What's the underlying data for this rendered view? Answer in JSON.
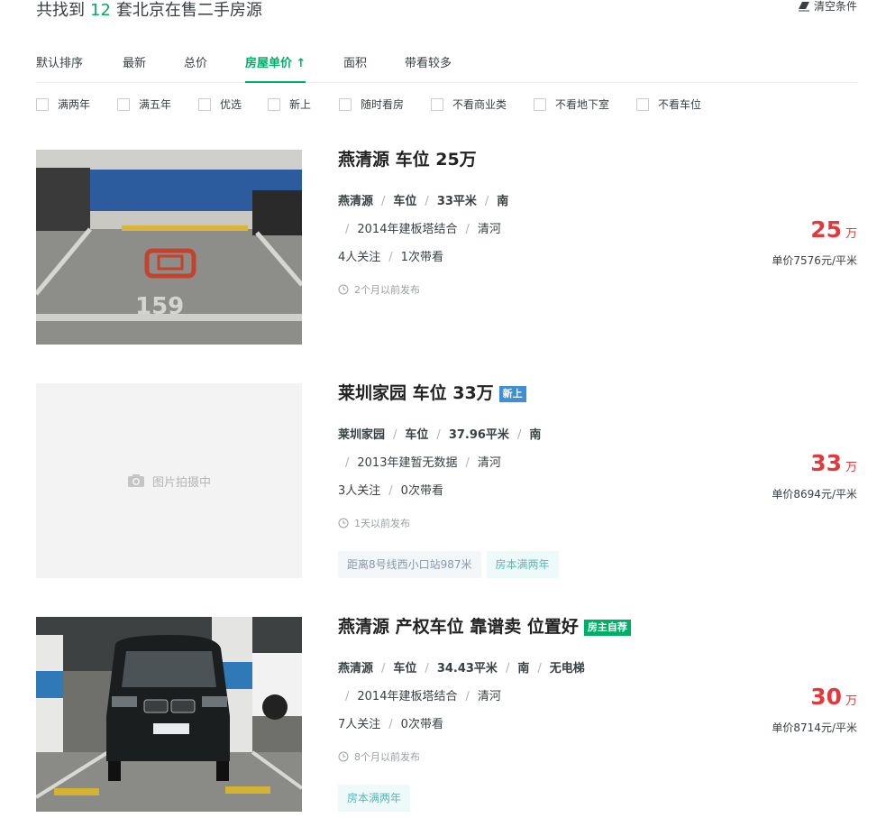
{
  "header": {
    "count_prefix": "共找到",
    "count": "12",
    "count_suffix": "套北京在售二手房源",
    "clear_label": "清空条件"
  },
  "sort_tabs": [
    {
      "label": "默认排序"
    },
    {
      "label": "最新"
    },
    {
      "label": "总价"
    },
    {
      "label": "房屋单价 ↑",
      "active": true
    },
    {
      "label": "面积"
    },
    {
      "label": "带看较多"
    }
  ],
  "filters": [
    {
      "label": "满两年"
    },
    {
      "label": "满五年"
    },
    {
      "label": "优选"
    },
    {
      "label": "新上"
    },
    {
      "label": "随时看房"
    },
    {
      "label": "不看商业类"
    },
    {
      "label": "不看地下室"
    },
    {
      "label": "不看车位"
    }
  ],
  "listings": [
    {
      "title": "燕清源 车位 25万",
      "badge": "",
      "info_line1": [
        "燕清源",
        "车位",
        "33平米",
        "南"
      ],
      "info_line2": [
        "2014年建板塔结合",
        "清河"
      ],
      "follow": "4人关注",
      "visits": "1次带看",
      "published": "2个月以前发布",
      "tags": [],
      "price_total": "25",
      "price_unit_word": "万",
      "unit_price": "单价7576元/平米",
      "image": "parking-spot-photo"
    },
    {
      "title": "莱圳家园 车位 33万",
      "badge": "新上",
      "info_line1": [
        "莱圳家园",
        "车位",
        "37.96平米",
        "南"
      ],
      "info_line2": [
        "2013年建暂无数据",
        "清河"
      ],
      "follow": "3人关注",
      "visits": "0次带看",
      "published": "1天以前发布",
      "tags": [
        "距离8号线西小口站987米",
        "房本满两年"
      ],
      "price_total": "33",
      "price_unit_word": "万",
      "unit_price": "单价8694元/平米",
      "image_placeholder": "图片拍摄中"
    },
    {
      "title": "燕清源 产权车位 靠谱卖 位置好",
      "badge": "房主自荐",
      "info_line1": [
        "燕清源",
        "车位",
        "34.43平米",
        "南",
        "无电梯"
      ],
      "info_line2": [
        "2014年建板塔结合",
        "清河"
      ],
      "follow": "7人关注",
      "visits": "0次带看",
      "published": "8个月以前发布",
      "tags": [
        "房本满两年"
      ],
      "price_total": "30",
      "price_unit_word": "万",
      "unit_price": "单价8714元/平米",
      "image": "parked-car-photo"
    }
  ],
  "colors": {
    "accent": "#00ae66",
    "price": "#e4393c",
    "badge_new": "#3e8fd6",
    "badge_owner": "#00ae66"
  }
}
